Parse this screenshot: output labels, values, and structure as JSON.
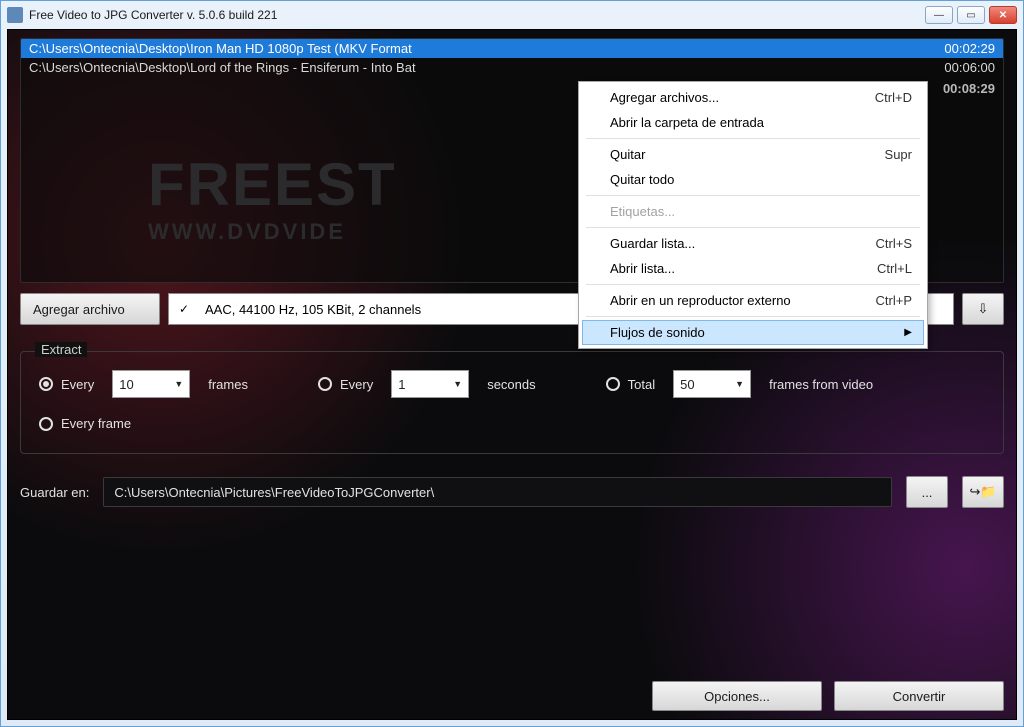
{
  "window": {
    "title": "Free Video to JPG Converter  v. 5.0.6 build 221"
  },
  "watermark": {
    "line1": "FREEST",
    "line2": "WWW.DVDVIDE"
  },
  "files": [
    {
      "path": "C:\\Users\\Ontecnia\\Desktop\\Iron Man HD 1080p Test (MKV Format",
      "duration": "00:02:29",
      "selected": true
    },
    {
      "path": "C:\\Users\\Ontecnia\\Desktop\\Lord of the Rings - Ensiferum - Into Bat",
      "duration": "00:06:00",
      "selected": false
    }
  ],
  "files_total": "00:08:29",
  "toolbar": {
    "add_files": "Agregar archivo",
    "audio_stream": "AAC, 44100 Hz, 105 KBit, 2 channels",
    "down_arrow": "⇩"
  },
  "context_menu": {
    "add_files": "Agregar archivos...",
    "add_files_accel": "Ctrl+D",
    "open_input_folder": "Abrir la carpeta de entrada",
    "remove": "Quitar",
    "remove_accel": "Supr",
    "remove_all": "Quitar todo",
    "tags": "Etiquetas...",
    "save_list": "Guardar lista...",
    "save_list_accel": "Ctrl+S",
    "open_list": "Abrir lista...",
    "open_list_accel": "Ctrl+L",
    "open_external": "Abrir en un reproductor externo",
    "open_external_accel": "Ctrl+P",
    "audio_streams": "Flujos de sonido"
  },
  "extract": {
    "legend": "Extract",
    "every_frames_label": "Every",
    "every_frames_value": "10",
    "frames_suffix": "frames",
    "every_seconds_label": "Every",
    "every_seconds_value": "1",
    "seconds_suffix": "seconds",
    "total_label": "Total",
    "total_value": "50",
    "total_suffix": "frames from video",
    "every_frame_label": "Every frame"
  },
  "save": {
    "label": "Guardar en:",
    "path": "C:\\Users\\Ontecnia\\Pictures\\FreeVideoToJPGConverter\\",
    "browse": "...",
    "open": "↪📁"
  },
  "footer": {
    "options": "Opciones...",
    "convert": "Convertir"
  }
}
